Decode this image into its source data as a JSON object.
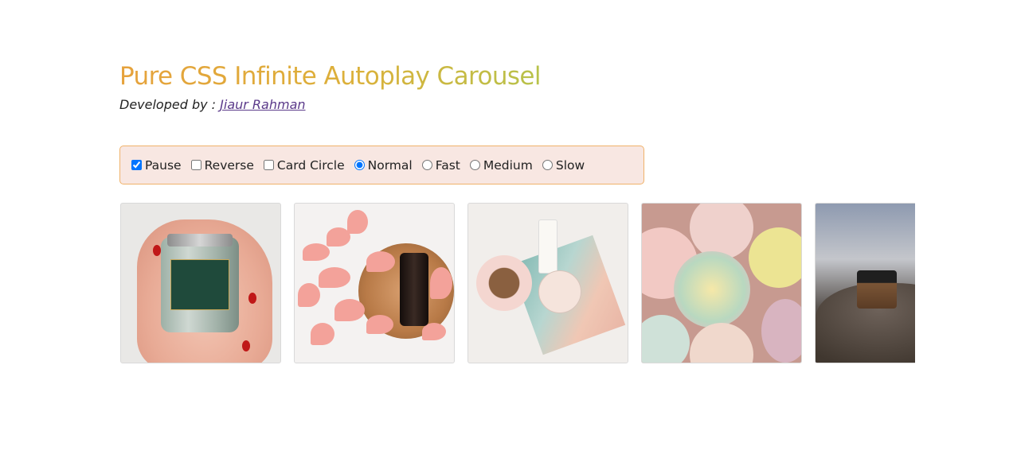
{
  "header": {
    "title": "Pure CSS Infinite Autoplay Carousel",
    "developed_by_label": "Developed by :",
    "author_name": "Jiaur Rahman"
  },
  "controls": {
    "checkboxes": [
      {
        "label": "Pause",
        "checked": true
      },
      {
        "label": "Reverse",
        "checked": false
      },
      {
        "label": "Card Circle",
        "checked": false
      }
    ],
    "speed_radios": [
      {
        "label": "Normal",
        "checked": true
      },
      {
        "label": "Fast",
        "checked": false
      },
      {
        "label": "Medium",
        "checked": false
      },
      {
        "label": "Slow",
        "checked": false
      }
    ]
  },
  "carousel": {
    "cards": [
      {
        "subject": "jar-in-hand-photo"
      },
      {
        "subject": "rose-petals-bottle-photo"
      },
      {
        "subject": "cosmetics-flatlay-photo"
      },
      {
        "subject": "bath-bombs-photo"
      },
      {
        "subject": "jar-on-rocks-photo"
      }
    ]
  },
  "colors": {
    "title_gradient_start": "#e6a23c",
    "title_gradient_end": "#b7c24a",
    "controls_background": "#f8e7e2",
    "controls_border": "#f0b26a",
    "link": "#5b3a8a"
  }
}
